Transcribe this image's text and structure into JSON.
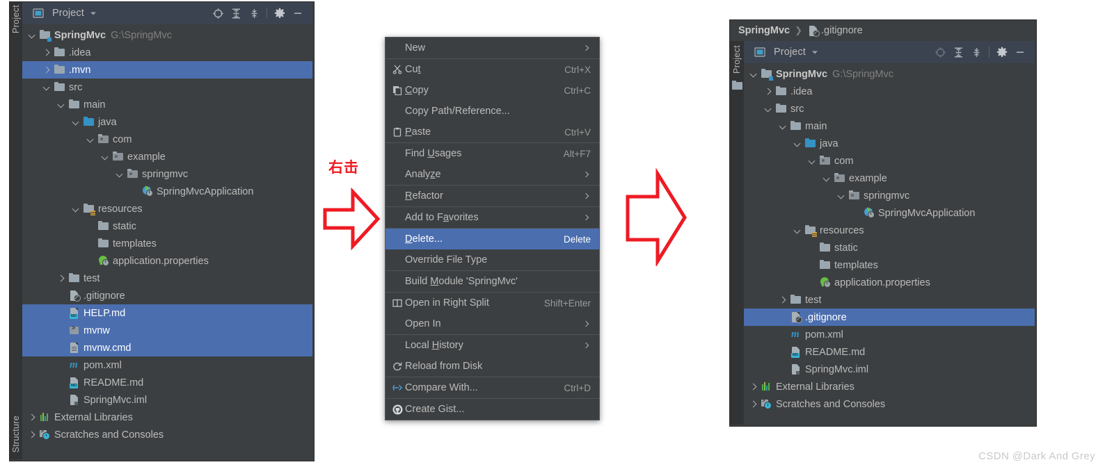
{
  "left_panel": {
    "tool_tab_top": "Project",
    "tool_tab_bottom": "Structure",
    "toolbar": {
      "title": "Project",
      "dropdown": "chevron-down-icon",
      "icons": [
        "locate-icon",
        "expand-all-icon",
        "collapse-all-icon",
        "settings-gear-icon",
        "hide-icon"
      ]
    },
    "tree": [
      {
        "label": "SpringMvc",
        "suffix": "G:\\SpringMvc",
        "icon": "module-folder-icon",
        "arrow": "down",
        "indent": 0,
        "bold": true,
        "selected": false
      },
      {
        "label": ".idea",
        "suffix": "",
        "icon": "folder-icon",
        "arrow": "right",
        "indent": 1,
        "bold": false,
        "selected": false
      },
      {
        "label": ".mvn",
        "suffix": "",
        "icon": "folder-icon",
        "arrow": "right",
        "indent": 1,
        "bold": false,
        "selected": true
      },
      {
        "label": "src",
        "suffix": "",
        "icon": "folder-icon",
        "arrow": "down",
        "indent": 1,
        "bold": false,
        "selected": false
      },
      {
        "label": "main",
        "suffix": "",
        "icon": "folder-icon",
        "arrow": "down",
        "indent": 2,
        "bold": false,
        "selected": false
      },
      {
        "label": "java",
        "suffix": "",
        "icon": "source-folder-icon",
        "arrow": "down",
        "indent": 3,
        "bold": false,
        "selected": false
      },
      {
        "label": "com",
        "suffix": "",
        "icon": "package-icon",
        "arrow": "down",
        "indent": 4,
        "bold": false,
        "selected": false
      },
      {
        "label": "example",
        "suffix": "",
        "icon": "package-icon",
        "arrow": "down",
        "indent": 5,
        "bold": false,
        "selected": false
      },
      {
        "label": "springmvc",
        "suffix": "",
        "icon": "package-icon",
        "arrow": "down",
        "indent": 6,
        "bold": false,
        "selected": false
      },
      {
        "label": "SpringMvcApplication",
        "suffix": "",
        "icon": "spring-boot-class-icon",
        "arrow": "none",
        "indent": 7,
        "bold": false,
        "selected": false
      },
      {
        "label": "resources",
        "suffix": "",
        "icon": "resources-folder-icon",
        "arrow": "down",
        "indent": 3,
        "bold": false,
        "selected": false
      },
      {
        "label": "static",
        "suffix": "",
        "icon": "folder-icon",
        "arrow": "none",
        "indent": 4,
        "bold": false,
        "selected": false
      },
      {
        "label": "templates",
        "suffix": "",
        "icon": "folder-icon",
        "arrow": "none",
        "indent": 4,
        "bold": false,
        "selected": false
      },
      {
        "label": "application.properties",
        "suffix": "",
        "icon": "spring-properties-icon",
        "arrow": "none",
        "indent": 4,
        "bold": false,
        "selected": false
      },
      {
        "label": "test",
        "suffix": "",
        "icon": "folder-icon",
        "arrow": "right",
        "indent": 2,
        "bold": false,
        "selected": false
      },
      {
        "label": ".gitignore",
        "suffix": "",
        "icon": "gitignore-file-icon",
        "arrow": "none",
        "indent": 2,
        "bold": false,
        "selected": false
      },
      {
        "label": "HELP.md",
        "suffix": "",
        "icon": "markdown-file-icon",
        "arrow": "none",
        "indent": 2,
        "bold": false,
        "selected": true
      },
      {
        "label": "mvnw",
        "suffix": "",
        "icon": "shell-script-icon",
        "arrow": "none",
        "indent": 2,
        "bold": false,
        "selected": true
      },
      {
        "label": "mvnw.cmd",
        "suffix": "",
        "icon": "cmd-file-icon",
        "arrow": "none",
        "indent": 2,
        "bold": false,
        "selected": true
      },
      {
        "label": "pom.xml",
        "suffix": "",
        "icon": "maven-file-icon",
        "arrow": "none",
        "indent": 2,
        "bold": false,
        "selected": false
      },
      {
        "label": "README.md",
        "suffix": "",
        "icon": "markdown-file-icon",
        "arrow": "none",
        "indent": 2,
        "bold": false,
        "selected": false
      },
      {
        "label": "SpringMvc.iml",
        "suffix": "",
        "icon": "iml-file-icon",
        "arrow": "none",
        "indent": 2,
        "bold": false,
        "selected": false
      },
      {
        "label": "External Libraries",
        "suffix": "",
        "icon": "libraries-icon",
        "arrow": "right",
        "indent": 0,
        "bold": false,
        "selected": false
      },
      {
        "label": "Scratches and Consoles",
        "suffix": "",
        "icon": "scratches-icon",
        "arrow": "right",
        "indent": 0,
        "bold": false,
        "selected": false
      }
    ]
  },
  "context_menu": {
    "items": [
      {
        "type": "item",
        "label": "New",
        "mnemonic": "",
        "icon": "",
        "shortcut": "",
        "submenu": true,
        "highlighted": false
      },
      {
        "type": "sep"
      },
      {
        "type": "item",
        "label": "Cut",
        "mnemonic": "t",
        "icon": "cut-scissors-icon",
        "shortcut": "Ctrl+X",
        "submenu": false,
        "highlighted": false
      },
      {
        "type": "item",
        "label": "Copy",
        "mnemonic": "C",
        "icon": "copy-icon",
        "shortcut": "Ctrl+C",
        "submenu": false,
        "highlighted": false
      },
      {
        "type": "item",
        "label": "Copy Path/Reference...",
        "mnemonic": "",
        "icon": "",
        "shortcut": "",
        "submenu": false,
        "highlighted": false
      },
      {
        "type": "item",
        "label": "Paste",
        "mnemonic": "P",
        "icon": "paste-clipboard-icon",
        "shortcut": "Ctrl+V",
        "submenu": false,
        "highlighted": false
      },
      {
        "type": "sep"
      },
      {
        "type": "item",
        "label": "Find Usages",
        "mnemonic": "U",
        "icon": "",
        "shortcut": "Alt+F7",
        "submenu": false,
        "highlighted": false
      },
      {
        "type": "item",
        "label": "Analyze",
        "mnemonic": "z",
        "icon": "",
        "shortcut": "",
        "submenu": true,
        "highlighted": false
      },
      {
        "type": "sep"
      },
      {
        "type": "item",
        "label": "Refactor",
        "mnemonic": "R",
        "icon": "",
        "shortcut": "",
        "submenu": true,
        "highlighted": false
      },
      {
        "type": "sep"
      },
      {
        "type": "item",
        "label": "Add to Favorites",
        "mnemonic": "a",
        "icon": "",
        "shortcut": "",
        "submenu": true,
        "highlighted": false
      },
      {
        "type": "sep"
      },
      {
        "type": "item",
        "label": "Delete...",
        "mnemonic": "D",
        "icon": "",
        "shortcut": "Delete",
        "submenu": false,
        "highlighted": true
      },
      {
        "type": "item",
        "label": "Override File Type",
        "mnemonic": "",
        "icon": "",
        "shortcut": "",
        "submenu": false,
        "highlighted": false
      },
      {
        "type": "sep"
      },
      {
        "type": "item",
        "label": "Build Module 'SpringMvc'",
        "mnemonic": "M",
        "icon": "",
        "shortcut": "",
        "submenu": false,
        "highlighted": false
      },
      {
        "type": "sep"
      },
      {
        "type": "item",
        "label": "Open in Right Split",
        "mnemonic": "",
        "icon": "split-right-icon",
        "shortcut": "Shift+Enter",
        "submenu": false,
        "highlighted": false
      },
      {
        "type": "item",
        "label": "Open In",
        "mnemonic": "",
        "icon": "",
        "shortcut": "",
        "submenu": true,
        "highlighted": false
      },
      {
        "type": "sep"
      },
      {
        "type": "item",
        "label": "Local History",
        "mnemonic": "H",
        "icon": "",
        "shortcut": "",
        "submenu": true,
        "highlighted": false
      },
      {
        "type": "item",
        "label": "Reload from Disk",
        "mnemonic": "",
        "icon": "reload-icon",
        "shortcut": "",
        "submenu": false,
        "highlighted": false
      },
      {
        "type": "sep"
      },
      {
        "type": "item",
        "label": "Compare With...",
        "mnemonic": "",
        "icon": "compare-icon",
        "shortcut": "Ctrl+D",
        "submenu": false,
        "highlighted": false
      },
      {
        "type": "sep"
      },
      {
        "type": "item",
        "label": "Create Gist...",
        "mnemonic": "",
        "icon": "github-icon",
        "shortcut": "",
        "submenu": false,
        "highlighted": false
      }
    ]
  },
  "right_panel": {
    "breadcrumb": {
      "project": "SpringMvc",
      "separator": "❯",
      "file": ".gitignore",
      "file_icon": "gitignore-file-icon"
    },
    "tool_tab": "Project",
    "toolbar": {
      "title": "Project",
      "dropdown": "chevron-down-icon",
      "icons": [
        "locate-icon",
        "expand-all-icon",
        "collapse-all-icon",
        "settings-gear-icon",
        "hide-icon"
      ]
    },
    "tree": [
      {
        "label": "SpringMvc",
        "suffix": "G:\\SpringMvc",
        "icon": "module-folder-icon",
        "arrow": "down",
        "indent": 0,
        "bold": true,
        "selected": false
      },
      {
        "label": ".idea",
        "suffix": "",
        "icon": "folder-icon",
        "arrow": "right",
        "indent": 1,
        "bold": false,
        "selected": false
      },
      {
        "label": "src",
        "suffix": "",
        "icon": "folder-icon",
        "arrow": "down",
        "indent": 1,
        "bold": false,
        "selected": false
      },
      {
        "label": "main",
        "suffix": "",
        "icon": "folder-icon",
        "arrow": "down",
        "indent": 2,
        "bold": false,
        "selected": false
      },
      {
        "label": "java",
        "suffix": "",
        "icon": "source-folder-icon",
        "arrow": "down",
        "indent": 3,
        "bold": false,
        "selected": false
      },
      {
        "label": "com",
        "suffix": "",
        "icon": "package-icon",
        "arrow": "down",
        "indent": 4,
        "bold": false,
        "selected": false
      },
      {
        "label": "example",
        "suffix": "",
        "icon": "package-icon",
        "arrow": "down",
        "indent": 5,
        "bold": false,
        "selected": false
      },
      {
        "label": "springmvc",
        "suffix": "",
        "icon": "package-icon",
        "arrow": "down",
        "indent": 6,
        "bold": false,
        "selected": false
      },
      {
        "label": "SpringMvcApplication",
        "suffix": "",
        "icon": "spring-boot-class-icon",
        "arrow": "none",
        "indent": 7,
        "bold": false,
        "selected": false
      },
      {
        "label": "resources",
        "suffix": "",
        "icon": "resources-folder-icon",
        "arrow": "down",
        "indent": 3,
        "bold": false,
        "selected": false
      },
      {
        "label": "static",
        "suffix": "",
        "icon": "folder-icon",
        "arrow": "none",
        "indent": 4,
        "bold": false,
        "selected": false
      },
      {
        "label": "templates",
        "suffix": "",
        "icon": "folder-icon",
        "arrow": "none",
        "indent": 4,
        "bold": false,
        "selected": false
      },
      {
        "label": "application.properties",
        "suffix": "",
        "icon": "spring-properties-icon",
        "arrow": "none",
        "indent": 4,
        "bold": false,
        "selected": false
      },
      {
        "label": "test",
        "suffix": "",
        "icon": "folder-icon",
        "arrow": "right",
        "indent": 2,
        "bold": false,
        "selected": false
      },
      {
        "label": ".gitignore",
        "suffix": "",
        "icon": "gitignore-file-icon",
        "arrow": "none",
        "indent": 2,
        "bold": false,
        "selected": true
      },
      {
        "label": "pom.xml",
        "suffix": "",
        "icon": "maven-file-icon",
        "arrow": "none",
        "indent": 2,
        "bold": false,
        "selected": false
      },
      {
        "label": "README.md",
        "suffix": "",
        "icon": "markdown-file-icon",
        "arrow": "none",
        "indent": 2,
        "bold": false,
        "selected": false
      },
      {
        "label": "SpringMvc.iml",
        "suffix": "",
        "icon": "iml-file-icon",
        "arrow": "none",
        "indent": 2,
        "bold": false,
        "selected": false
      },
      {
        "label": "External Libraries",
        "suffix": "",
        "icon": "libraries-icon",
        "arrow": "right",
        "indent": 0,
        "bold": false,
        "selected": false
      },
      {
        "label": "Scratches and Consoles",
        "suffix": "",
        "icon": "scratches-icon",
        "arrow": "right",
        "indent": 0,
        "bold": false,
        "selected": false
      }
    ]
  },
  "annotations": {
    "right_click_label": "右击",
    "arrow1": "red-block-arrow-right",
    "arrow2": "red-block-arrow-right"
  },
  "watermark": "CSDN @Dark And Grey",
  "colors": {
    "panel_bg": "#3c3f41",
    "toolbar_bg": "#3c4350",
    "selection_blue": "#4b6eaf",
    "text": "#bbbbbb",
    "dim_text": "#808080",
    "annotation_red": "#ee1b24",
    "accent_blue": "#3592c4",
    "accent_green": "#68bd45"
  }
}
